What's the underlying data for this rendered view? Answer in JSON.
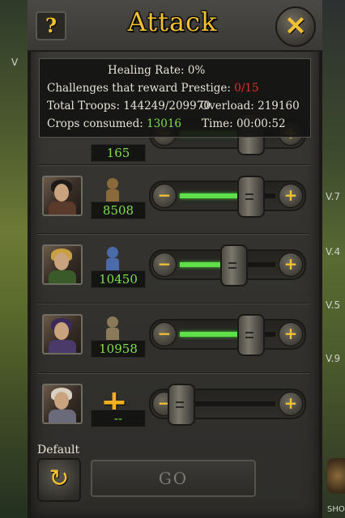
{
  "header": {
    "title": "Attack",
    "help_glyph": "?",
    "close_glyph": "✕"
  },
  "info": {
    "healing_label": "Healing Rate:",
    "healing_value": "0%",
    "prestige_label": "Challenges that reward Prestige:",
    "prestige_value": "0/15",
    "troops_label": "Total Troops:",
    "troops_value": "144249/209970",
    "overload_label": "Overload:",
    "overload_value": "219160",
    "crops_label": "Crops consumed:",
    "crops_value": "13016",
    "time_label": "Time:",
    "time_value": "00:00:52"
  },
  "rows": [
    {
      "count": "165",
      "fraction": 0.75
    },
    {
      "count": "8508",
      "fraction": 0.75
    },
    {
      "count": "10450",
      "fraction": 0.57
    },
    {
      "count": "10958",
      "fraction": 0.75
    },
    {
      "count": "--",
      "fraction": 0.0
    }
  ],
  "slider": {
    "minus": "−",
    "plus": "+"
  },
  "footer": {
    "default_label": "Default",
    "go_label": "GO",
    "reset_glyph": "↻"
  },
  "edges": {
    "left_letter": "V",
    "right_v7": "V.7",
    "right_v4": "V.4",
    "right_v5": "V.5",
    "right_v9": "V.9",
    "right_bottom": "SHO"
  },
  "colors": {
    "accent": "#f0c030",
    "green": "#7ee04a",
    "red": "#e0302a"
  }
}
